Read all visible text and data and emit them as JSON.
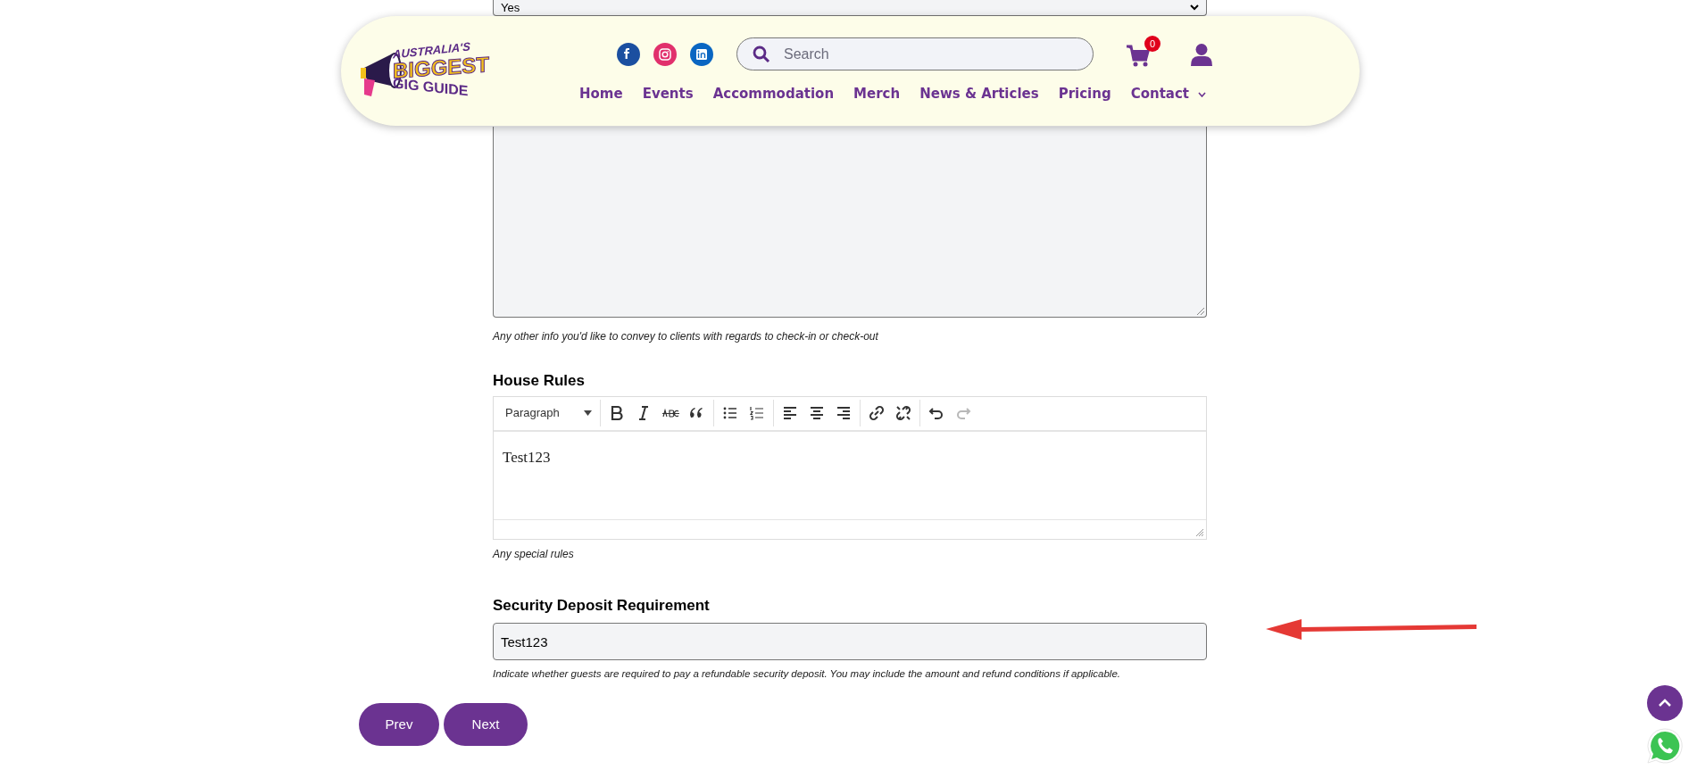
{
  "top_select": {
    "value": "Yes"
  },
  "header": {
    "logo": {
      "lines": [
        "AUSTRALIA'S",
        "BIGGEST",
        "GIG GUIDE"
      ]
    },
    "social": [
      {
        "kind": "facebook",
        "color": "#1b4fa0"
      },
      {
        "kind": "instagram",
        "color": "#e1306c"
      },
      {
        "kind": "linkedin",
        "color": "#0a66c2"
      }
    ],
    "search": {
      "placeholder": "Search"
    },
    "cart_count": "0",
    "nav": [
      {
        "label": "Home",
        "has_menu": false
      },
      {
        "label": "Events",
        "has_menu": false
      },
      {
        "label": "Accommodation",
        "has_menu": false
      },
      {
        "label": "Merch",
        "has_menu": false
      },
      {
        "label": "News & Articles",
        "has_menu": false
      },
      {
        "label": "Pricing",
        "has_menu": false
      },
      {
        "label": "Contact",
        "has_menu": true
      }
    ]
  },
  "checkin_info": {
    "hint": "Any other info you'd like to convey to clients with regards to check-in or check-out"
  },
  "house_rules": {
    "label": "House Rules",
    "format": "Paragraph",
    "tools": [
      {
        "kind": "bold",
        "disabled": false
      },
      {
        "kind": "italic",
        "disabled": false
      },
      {
        "kind": "strikethrough",
        "disabled": false
      },
      {
        "kind": "quote",
        "disabled": false
      },
      {
        "kind": "sep"
      },
      {
        "kind": "bullets",
        "disabled": false
      },
      {
        "kind": "numbers",
        "disabled": false
      },
      {
        "kind": "sep"
      },
      {
        "kind": "align-left",
        "disabled": false
      },
      {
        "kind": "align-center",
        "disabled": false
      },
      {
        "kind": "align-right",
        "disabled": false
      },
      {
        "kind": "sep"
      },
      {
        "kind": "link",
        "disabled": false
      },
      {
        "kind": "unlink",
        "disabled": false
      },
      {
        "kind": "sep"
      },
      {
        "kind": "undo",
        "disabled": false
      },
      {
        "kind": "redo",
        "disabled": true
      }
    ],
    "content": "Test123",
    "hint": "Any special rules"
  },
  "security_deposit": {
    "label": "Security Deposit Requirement",
    "value": "Test123",
    "hint": "Indicate whether guests are required to pay a refundable security deposit. You may include the amount and refund conditions if applicable."
  },
  "buttons": [
    "Prev",
    "Next"
  ]
}
